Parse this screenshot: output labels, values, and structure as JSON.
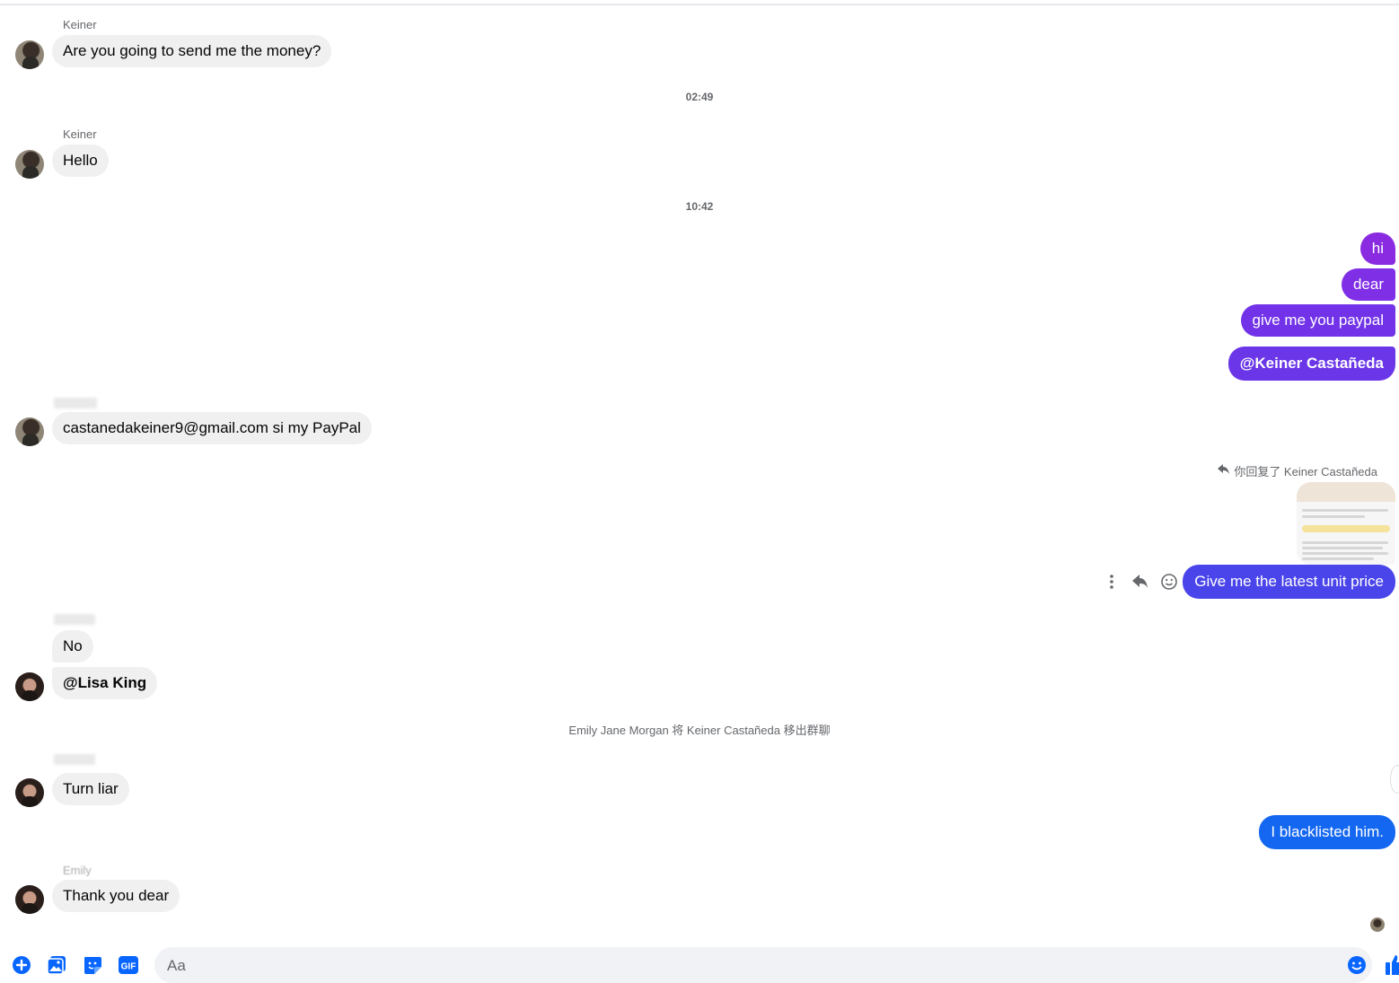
{
  "theme": {
    "incoming_bg": "#f0f0f0",
    "outgoing_purple": "#8a2be2",
    "outgoing_violet": "#6237e8",
    "outgoing_indigo": "#4a45ea",
    "outgoing_blue": "#1467f0",
    "accent": "#0866ff"
  },
  "messages": {
    "m1": {
      "sender": "Keiner",
      "text": "Are you going to send me the money?"
    },
    "ts1": "02:49",
    "m2": {
      "sender": "Keiner",
      "text": "Hello"
    },
    "ts2": "10:42",
    "out1": "hi",
    "out2": "dear",
    "out3": "give me you paypal",
    "out4": "@Keiner Castañeda",
    "m3": {
      "text": "castanedakeiner9@gmail.com si my PayPal"
    },
    "reply_indicator": "你回复了 Keiner Castañeda",
    "out5": "Give me the latest unit price",
    "m4": {
      "text": "No"
    },
    "m5": {
      "text": "@Lisa King"
    },
    "system_notice": "Emily Jane Morgan 将 Keiner Castañeda 移出群聊",
    "m6": {
      "text": "Turn liar"
    },
    "out6": "I blacklisted him.",
    "m7": {
      "sender": "Emily",
      "text": "Thank you dear"
    }
  },
  "composer": {
    "placeholder": "Aa",
    "value": "",
    "tools": [
      "plus-icon",
      "photo-icon",
      "sticker-icon",
      "gif-icon"
    ],
    "gif_label": "GIF",
    "emoji": "emoji-icon",
    "like": "thumbs-up-icon"
  },
  "hover_actions": [
    "more-icon",
    "reply-icon",
    "react-icon"
  ]
}
